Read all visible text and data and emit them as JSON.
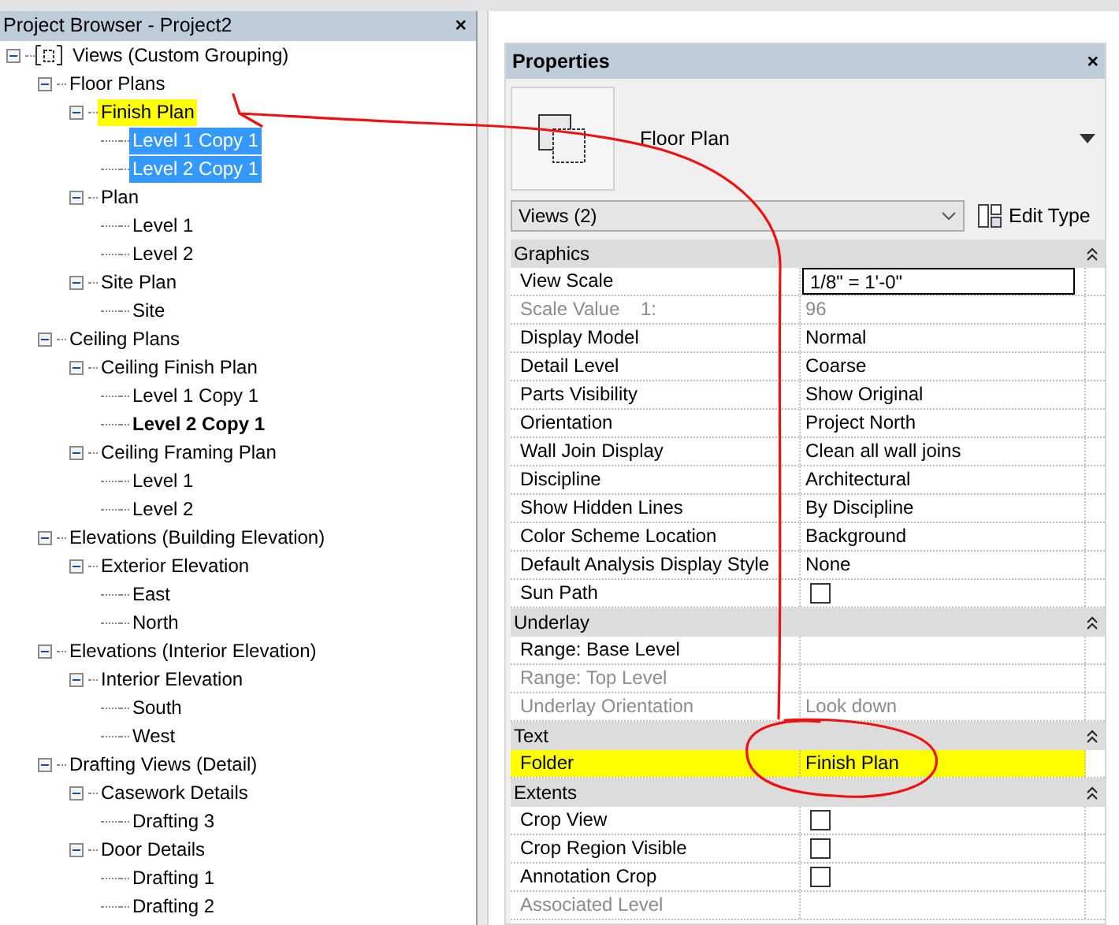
{
  "project_browser": {
    "title": "Project Browser - Project2",
    "close": "×",
    "tree": [
      {
        "label": "Views (Custom Grouping)",
        "kind": "root",
        "expanded": true,
        "highlighted": false,
        "children": [
          {
            "label": "Floor Plans",
            "kind": "group",
            "expanded": true,
            "highlighted": false,
            "children": [
              {
                "label": "Finish Plan",
                "kind": "group",
                "expanded": true,
                "highlighted": true,
                "children": [
                  {
                    "label": "Level 1 Copy 1",
                    "kind": "view",
                    "selected": true,
                    "active": false
                  },
                  {
                    "label": "Level 2 Copy 1",
                    "kind": "view",
                    "selected": true,
                    "active": false
                  }
                ]
              },
              {
                "label": "Plan",
                "kind": "group",
                "expanded": true,
                "highlighted": false,
                "children": [
                  {
                    "label": "Level 1",
                    "kind": "view",
                    "selected": false,
                    "active": false
                  },
                  {
                    "label": "Level 2",
                    "kind": "view",
                    "selected": false,
                    "active": false
                  }
                ]
              },
              {
                "label": "Site Plan",
                "kind": "group",
                "expanded": true,
                "highlighted": false,
                "children": [
                  {
                    "label": "Site",
                    "kind": "view",
                    "selected": false,
                    "active": false
                  }
                ]
              }
            ]
          },
          {
            "label": "Ceiling Plans",
            "kind": "group",
            "expanded": true,
            "highlighted": false,
            "children": [
              {
                "label": "Ceiling Finish Plan",
                "kind": "group",
                "expanded": true,
                "highlighted": false,
                "children": [
                  {
                    "label": "Level 1 Copy 1",
                    "kind": "view",
                    "selected": false,
                    "active": false
                  },
                  {
                    "label": "Level 2 Copy 1",
                    "kind": "view",
                    "selected": false,
                    "active": true
                  }
                ]
              },
              {
                "label": "Ceiling Framing Plan",
                "kind": "group",
                "expanded": true,
                "highlighted": false,
                "children": [
                  {
                    "label": "Level 1",
                    "kind": "view",
                    "selected": false,
                    "active": false
                  },
                  {
                    "label": "Level 2",
                    "kind": "view",
                    "selected": false,
                    "active": false
                  }
                ]
              }
            ]
          },
          {
            "label": "Elevations (Building Elevation)",
            "kind": "group",
            "expanded": true,
            "highlighted": false,
            "children": [
              {
                "label": "Exterior Elevation",
                "kind": "group",
                "expanded": true,
                "highlighted": false,
                "children": [
                  {
                    "label": "East",
                    "kind": "view",
                    "selected": false,
                    "active": false
                  },
                  {
                    "label": "North",
                    "kind": "view",
                    "selected": false,
                    "active": false
                  }
                ]
              }
            ]
          },
          {
            "label": "Elevations (Interior Elevation)",
            "kind": "group",
            "expanded": true,
            "highlighted": false,
            "children": [
              {
                "label": "Interior Elevation",
                "kind": "group",
                "expanded": true,
                "highlighted": false,
                "children": [
                  {
                    "label": "South",
                    "kind": "view",
                    "selected": false,
                    "active": false
                  },
                  {
                    "label": "West",
                    "kind": "view",
                    "selected": false,
                    "active": false
                  }
                ]
              }
            ]
          },
          {
            "label": "Drafting Views (Detail)",
            "kind": "group",
            "expanded": true,
            "highlighted": false,
            "children": [
              {
                "label": "Casework Details",
                "kind": "group",
                "expanded": true,
                "highlighted": false,
                "children": [
                  {
                    "label": "Drafting 3",
                    "kind": "view",
                    "selected": false,
                    "active": false
                  }
                ]
              },
              {
                "label": "Door Details",
                "kind": "group",
                "expanded": true,
                "highlighted": false,
                "children": [
                  {
                    "label": "Drafting 1",
                    "kind": "view",
                    "selected": false,
                    "active": false
                  },
                  {
                    "label": "Drafting 2",
                    "kind": "view",
                    "selected": false,
                    "active": false
                  }
                ]
              }
            ]
          }
        ]
      }
    ]
  },
  "properties": {
    "title": "Properties",
    "close": "×",
    "type_name": "Floor Plan",
    "filter": "Views (2)",
    "edit_type": "Edit Type",
    "sections": [
      {
        "title": "Graphics",
        "expanded": true,
        "rows": [
          {
            "label": "View Scale",
            "kind": "input",
            "value": "1/8\" = 1'-0\"",
            "disabled": false,
            "highlighted": false
          },
          {
            "label": "Scale Value    1:",
            "kind": "text",
            "value": "96",
            "disabled": true,
            "highlighted": false
          },
          {
            "label": "Display Model",
            "kind": "text",
            "value": "Normal",
            "disabled": false,
            "highlighted": false
          },
          {
            "label": "Detail Level",
            "kind": "text",
            "value": "Coarse",
            "disabled": false,
            "highlighted": false
          },
          {
            "label": "Parts Visibility",
            "kind": "text",
            "value": "Show Original",
            "disabled": false,
            "highlighted": false
          },
          {
            "label": "Orientation",
            "kind": "text",
            "value": "Project North",
            "disabled": false,
            "highlighted": false
          },
          {
            "label": "Wall Join Display",
            "kind": "text",
            "value": "Clean all wall joins",
            "disabled": false,
            "highlighted": false
          },
          {
            "label": "Discipline",
            "kind": "text",
            "value": "Architectural",
            "disabled": false,
            "highlighted": false
          },
          {
            "label": "Show Hidden Lines",
            "kind": "text",
            "value": "By Discipline",
            "disabled": false,
            "highlighted": false
          },
          {
            "label": "Color Scheme Location",
            "kind": "text",
            "value": "Background",
            "disabled": false,
            "highlighted": false
          },
          {
            "label": "Default Analysis Display Style",
            "kind": "text",
            "value": "None",
            "disabled": false,
            "highlighted": false
          },
          {
            "label": "Sun Path",
            "kind": "checkbox",
            "checked": false,
            "disabled": false,
            "highlighted": false
          }
        ]
      },
      {
        "title": "Underlay",
        "expanded": true,
        "rows": [
          {
            "label": "Range: Base Level",
            "kind": "text",
            "disabled": false,
            "highlighted": false
          },
          {
            "label": "Range: Top Level",
            "kind": "text",
            "disabled": true,
            "highlighted": false
          },
          {
            "label": "Underlay Orientation",
            "kind": "text",
            "value": "Look down",
            "disabled": true,
            "highlighted": false
          }
        ]
      },
      {
        "title": "Text",
        "expanded": true,
        "rows": [
          {
            "label": "Folder",
            "kind": "text",
            "value": "Finish Plan",
            "disabled": false,
            "highlighted": true
          }
        ]
      },
      {
        "title": "Extents",
        "expanded": true,
        "rows": [
          {
            "label": "Crop View",
            "kind": "checkbox",
            "checked": false,
            "disabled": false,
            "highlighted": false
          },
          {
            "label": "Crop Region Visible",
            "kind": "checkbox",
            "checked": false,
            "disabled": false,
            "highlighted": false
          },
          {
            "label": "Annotation Crop",
            "kind": "checkbox",
            "checked": false,
            "disabled": false,
            "highlighted": false
          },
          {
            "label": "Associated Level",
            "kind": "text",
            "disabled": true,
            "highlighted": false
          }
        ]
      }
    ]
  }
}
